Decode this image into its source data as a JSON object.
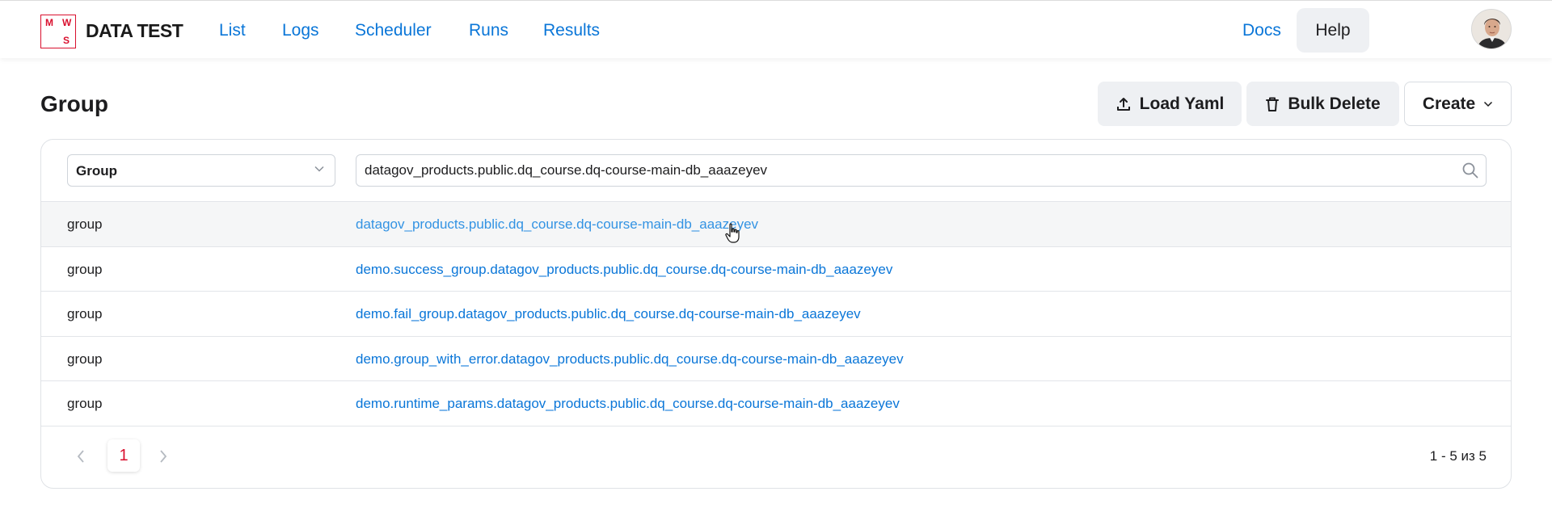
{
  "header": {
    "logo_letters": [
      "M",
      "W",
      "S"
    ],
    "brand": "DATA TEST",
    "nav": [
      "List",
      "Logs",
      "Scheduler",
      "Runs",
      "Results"
    ],
    "docs": "Docs",
    "help": "Help",
    "avatar_icon": "user-avatar"
  },
  "page": {
    "title": "Group",
    "actions": {
      "load_yaml": "Load Yaml",
      "bulk_delete": "Bulk Delete",
      "create": "Create"
    }
  },
  "filter": {
    "type_selected": "Group",
    "search_value": "datagov_products.public.dq_course.dq-course-main-db_aaazeyev"
  },
  "table": {
    "rows": [
      {
        "type": "group",
        "name": "datagov_products.public.dq_course.dq-course-main-db_aaazeyev"
      },
      {
        "type": "group",
        "name": "demo.success_group.datagov_products.public.dq_course.dq-course-main-db_aaazeyev"
      },
      {
        "type": "group",
        "name": "demo.fail_group.datagov_products.public.dq_course.dq-course-main-db_aaazeyev"
      },
      {
        "type": "group",
        "name": "demo.group_with_error.datagov_products.public.dq_course.dq-course-main-db_aaazeyev"
      },
      {
        "type": "group",
        "name": "demo.runtime_params.datagov_products.public.dq_course.dq-course-main-db_aaazeyev"
      }
    ]
  },
  "pagination": {
    "current_page": "1",
    "range_text": "1 - 5 из 5"
  },
  "colors": {
    "accent": "#0a76d8",
    "brand_red": "#d9102e"
  }
}
